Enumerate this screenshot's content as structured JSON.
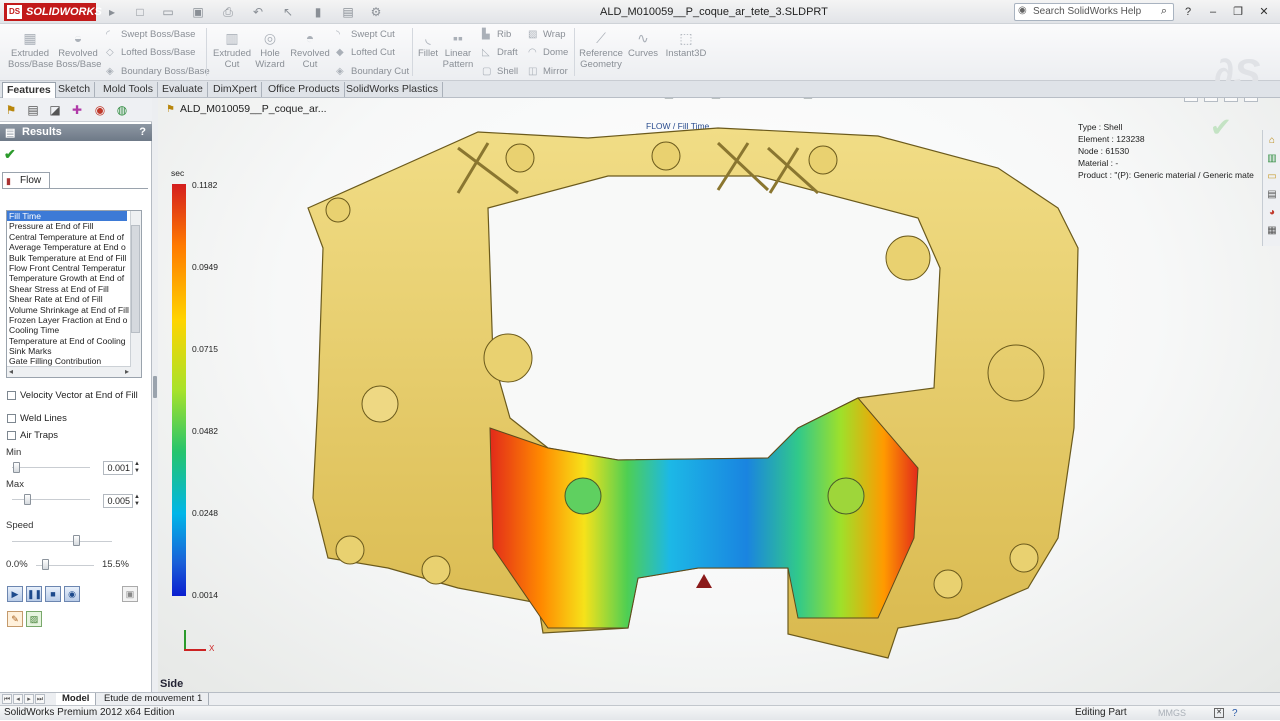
{
  "app": {
    "brand": "SOLIDWORKS",
    "document_title": "ALD_M010059__P_coque_ar_tete_3.SLDPRT"
  },
  "search": {
    "placeholder": "Search SolidWorks Help"
  },
  "ribbon": {
    "extruded_boss": "Extruded\nBoss/Base",
    "revolved_boss": "Revolved\nBoss/Base",
    "swept_boss": "Swept Boss/Base",
    "lofted_boss": "Lofted Boss/Base",
    "boundary_boss": "Boundary Boss/Base",
    "extruded_cut": "Extruded\nCut",
    "hole_wizard": "Hole\nWizard",
    "revolved_cut": "Revolved\nCut",
    "swept_cut": "Swept Cut",
    "lofted_cut": "Lofted Cut",
    "boundary_cut": "Boundary Cut",
    "fillet": "Fillet",
    "linear_pattern": "Linear\nPattern",
    "rib": "Rib",
    "draft": "Draft",
    "shell": "Shell",
    "wrap": "Wrap",
    "dome": "Dome",
    "mirror": "Mirror",
    "reference_geometry": "Reference\nGeometry",
    "curves": "Curves",
    "instant3d": "Instant3D"
  },
  "tabs": [
    "Features",
    "Sketch",
    "Mold Tools",
    "Evaluate",
    "DimXpert",
    "Office Products",
    "SolidWorks Plastics"
  ],
  "panel": {
    "title": "Results",
    "help": "?",
    "subtab": "Flow",
    "results_list": [
      "Fill Time",
      "Pressure at End of Fill",
      "Central Temperature at End of",
      "Average Temperature at End o",
      "Bulk Temperature at End of Fill",
      "Flow Front Central Temperatur",
      "Temperature Growth at End of",
      "Shear Stress at End of Fill",
      "Shear Rate at End of Fill",
      "Volume Shrinkage at End of Fill",
      "Frozen Layer Fraction at End o",
      "Cooling Time",
      "Temperature at End of Cooling",
      "Sink Marks",
      "Gate Filling Contribution"
    ],
    "velocity_vector": "Velocity Vector at End of Fill",
    "weld_lines": "Weld Lines",
    "air_traps": "Air Traps",
    "min_label": "Min",
    "min_value": "0.001",
    "max_label": "Max",
    "max_value": "0.005",
    "speed_label": "Speed",
    "range_start": "0.0%",
    "range_end": "15.5%"
  },
  "viewport": {
    "tree_path": "ALD_M010059__P_coque_ar...",
    "plot_title": "FLOW / Fill Time",
    "info": {
      "type": "Type : Shell",
      "element": "Element : 123238",
      "node": "Node : 61530",
      "material": "Material : -",
      "product": "Product :  \"(P): Generic material / Generic mate"
    },
    "legend_unit": "sec",
    "legend_ticks": [
      "0.1182",
      "0.0949",
      "0.0715",
      "0.0482",
      "0.0248",
      "0.0014"
    ],
    "view_name": "Side",
    "triad_x": "X"
  },
  "bottom_tabs": [
    "Model",
    "Etude de mouvement 1"
  ],
  "status": {
    "left": "SolidWorks Premium 2012 x64 Edition",
    "right": "Editing Part",
    "units": "MMGS"
  },
  "colors": {
    "accent": "#c21a1a",
    "part": "#e8cf6b",
    "selection": "#3d7ad6"
  }
}
